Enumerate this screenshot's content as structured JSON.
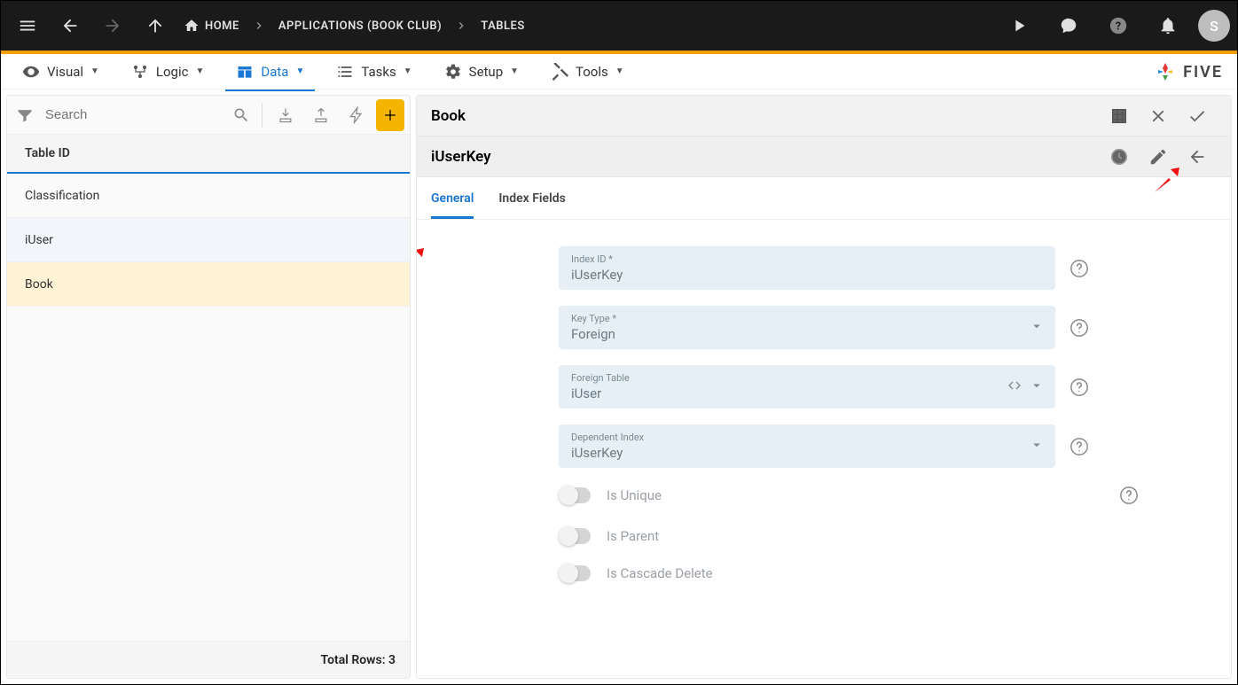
{
  "topbar": {
    "home": "HOME",
    "apps": "APPLICATIONS (BOOK CLUB)",
    "tables": "TABLES",
    "avatar_initial": "S"
  },
  "tabs": {
    "visual": "Visual",
    "logic": "Logic",
    "data": "Data",
    "tasks": "Tasks",
    "setup": "Setup",
    "tools": "Tools",
    "brand": "FIVE"
  },
  "sidebar": {
    "search_placeholder": "Search",
    "header": "Table ID",
    "rows": [
      "Classification",
      "iUser",
      "Book"
    ],
    "footer_label": "Total Rows:",
    "footer_count": "3"
  },
  "detail": {
    "title": "Book",
    "subtitle": "iUserKey",
    "subtabs": {
      "general": "General",
      "index_fields": "Index Fields"
    },
    "fields": {
      "index_id": {
        "label": "Index ID *",
        "value": "iUserKey"
      },
      "key_type": {
        "label": "Key Type *",
        "value": "Foreign"
      },
      "foreign_table": {
        "label": "Foreign Table",
        "value": "iUser"
      },
      "dependent_index": {
        "label": "Dependent Index",
        "value": "iUserKey"
      }
    },
    "toggles": {
      "is_unique": "Is Unique",
      "is_parent": "Is Parent",
      "is_cascade": "Is Cascade Delete"
    }
  }
}
